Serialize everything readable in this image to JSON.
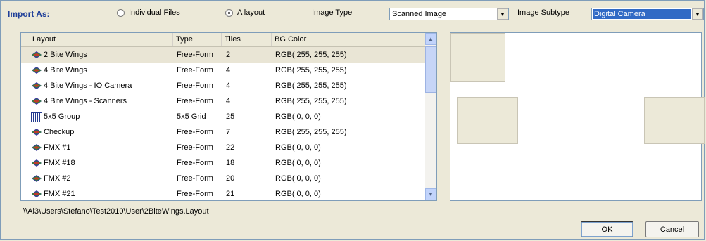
{
  "top_bar": {
    "import_as_label": "Import As:",
    "options": [
      {
        "label": "Individual Files",
        "checked": false
      },
      {
        "label": "A layout",
        "checked": true
      }
    ],
    "image_type_label": "Image Type",
    "image_type_value": "Scanned Image",
    "image_subtype_label": "Image Subtype",
    "image_subtype_value": "Digital Camera"
  },
  "layout_list": {
    "columns": [
      "Layout",
      "Type",
      "Tiles",
      "BG Color"
    ],
    "rows": [
      {
        "name": "2 Bite Wings",
        "type": "Free-Form",
        "tiles": "2",
        "bg": "RGB( 255, 255, 255)",
        "icon": "free-form-icon",
        "selected": true
      },
      {
        "name": "4 Bite Wings",
        "type": "Free-Form",
        "tiles": "4",
        "bg": "RGB( 255, 255, 255)",
        "icon": "free-form-icon"
      },
      {
        "name": "4 Bite Wings - IO Camera",
        "type": "Free-Form",
        "tiles": "4",
        "bg": "RGB( 255, 255, 255)",
        "icon": "free-form-icon"
      },
      {
        "name": "4 Bite Wings - Scanners",
        "type": "Free-Form",
        "tiles": "4",
        "bg": "RGB( 255, 255, 255)",
        "icon": "free-form-icon"
      },
      {
        "name": "5x5 Group",
        "type": "5x5 Grid",
        "tiles": "25",
        "bg": "RGB( 0, 0, 0)",
        "icon": "grid-icon"
      },
      {
        "name": "Checkup",
        "type": "Free-Form",
        "tiles": "7",
        "bg": "RGB( 255, 255, 255)",
        "icon": "free-form-icon"
      },
      {
        "name": "FMX #1",
        "type": "Free-Form",
        "tiles": "22",
        "bg": "RGB( 0, 0, 0)",
        "icon": "free-form-icon"
      },
      {
        "name": "FMX #18",
        "type": "Free-Form",
        "tiles": "18",
        "bg": "RGB( 0, 0, 0)",
        "icon": "free-form-icon"
      },
      {
        "name": "FMX #2",
        "type": "Free-Form",
        "tiles": "20",
        "bg": "RGB( 0, 0, 0)",
        "icon": "free-form-icon"
      },
      {
        "name": "FMX #21",
        "type": "Free-Form",
        "tiles": "21",
        "bg": "RGB( 0, 0, 0)",
        "icon": "free-form-icon"
      }
    ]
  },
  "file_path": "\\\\Ai3\\Users\\Stefano\\Test2010\\User\\2BiteWings.Layout",
  "buttons": {
    "ok": "OK",
    "cancel": "Cancel"
  },
  "colors": {
    "accent": "#316ac5",
    "label_blue": "#1f3f99",
    "panel": "#ece9d8"
  }
}
